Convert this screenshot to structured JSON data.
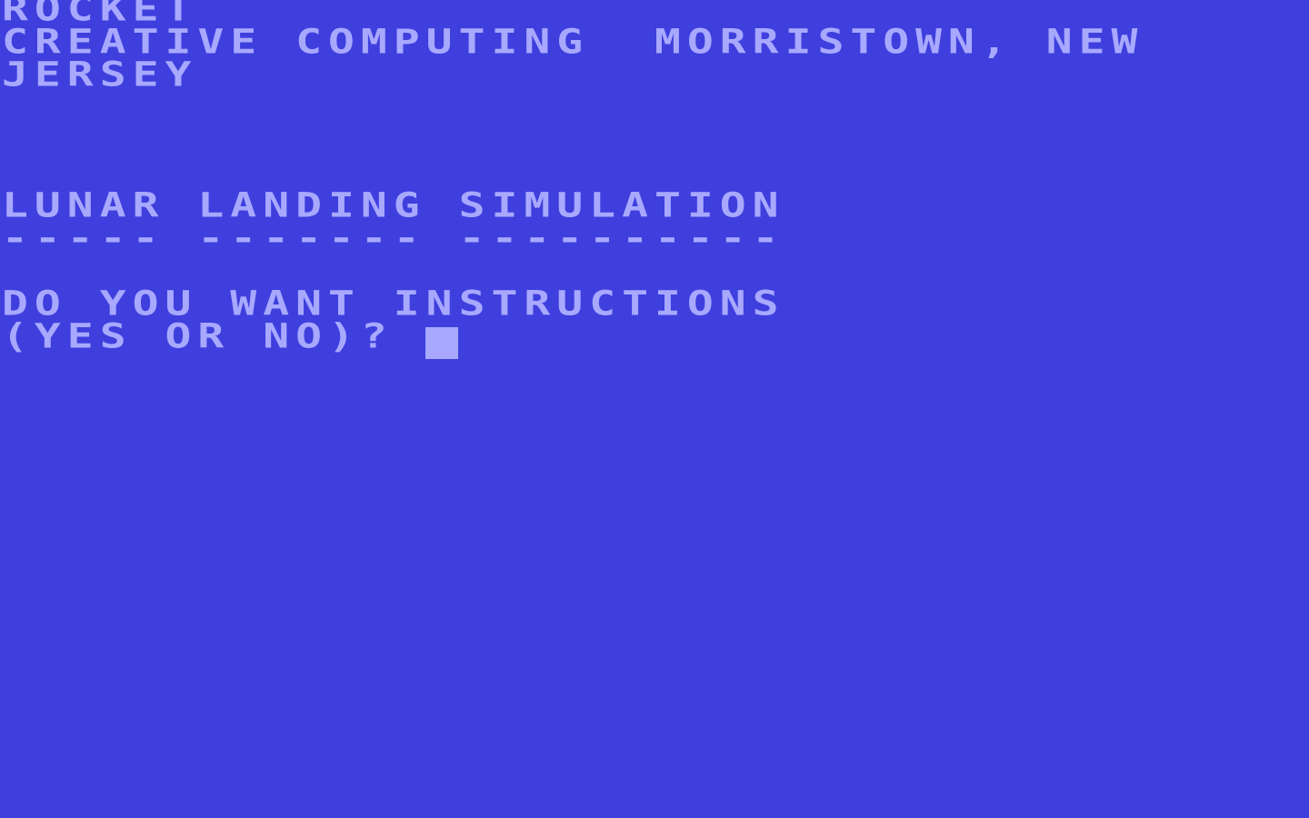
{
  "colors": {
    "background": "#3e3fdd",
    "foreground": "#a8a8ff"
  },
  "terminal": {
    "lines": [
      "ROCKET",
      "CREATIVE COMPUTING  MORRISTOWN, NEW",
      "JERSEY",
      "",
      "",
      "",
      "LUNAR LANDING SIMULATION",
      "----- ------- ----------",
      "",
      "DO YOU WANT INSTRUCTIONS",
      "(YES OR NO)? "
    ]
  }
}
